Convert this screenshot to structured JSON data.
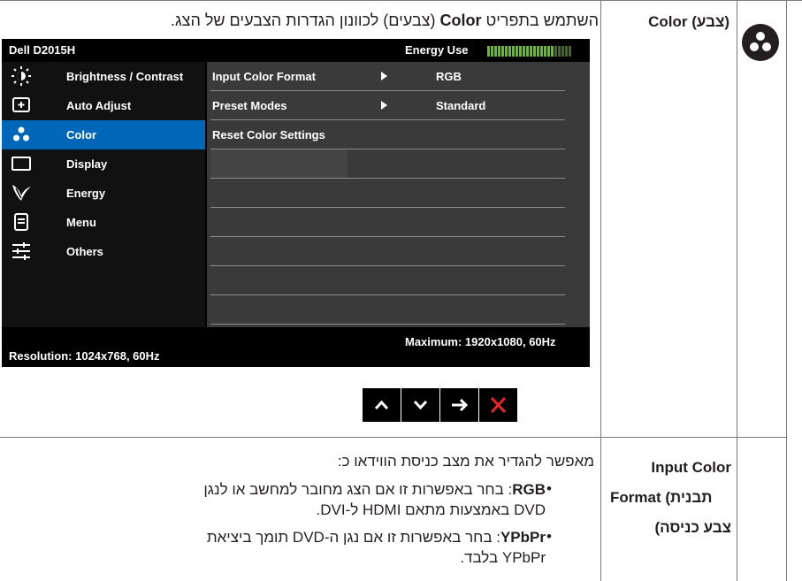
{
  "top_section": {
    "label": "Color (צבע)",
    "description_pre": "השתמש בתפריט ",
    "description_bold": "Color",
    "description_post": " (צבעים) לכוונון הגדרות הצבעים של הצג."
  },
  "osd": {
    "model": "Dell D2015H",
    "energy_label": "Energy Use",
    "energy_level": 0.8,
    "menu_items": [
      {
        "label": "Brightness / Contrast",
        "icon": "brightness-icon"
      },
      {
        "label": "Auto Adjust",
        "icon": "auto-adjust-icon"
      },
      {
        "label": "Color",
        "icon": "color-icon",
        "active": true
      },
      {
        "label": "Display",
        "icon": "display-icon"
      },
      {
        "label": "Energy",
        "icon": "energy-leaf-icon"
      },
      {
        "label": "Menu",
        "icon": "menu-icon"
      },
      {
        "label": "Others",
        "icon": "others-sliders-icon"
      }
    ],
    "submenu": [
      {
        "label": "Input Color Format",
        "value": "RGB",
        "has_arrow": true
      },
      {
        "label": "Preset Modes",
        "value": "Standard",
        "has_arrow": true
      },
      {
        "label": "Reset Color Settings",
        "value": "",
        "has_arrow": false
      }
    ],
    "resolution": "Resolution: 1024x768, 60Hz",
    "maximum": "Maximum: 1920x1080, 60Hz",
    "active_color": "#0067b8"
  },
  "nav_buttons": [
    {
      "icon": "chevron-up-icon"
    },
    {
      "icon": "chevron-down-icon"
    },
    {
      "icon": "arrow-right-icon"
    },
    {
      "icon": "close-x-icon",
      "color": "#e8262c"
    }
  ],
  "bottom_section": {
    "label_line1": "Input Color",
    "label_line2": "Format (תבנית",
    "label_line3": "צבע כניסה)",
    "intro": "מאפשר להגדיר את מצב כניסת הווידאו כ:",
    "bullets": [
      {
        "bold": "RGB",
        "line1": ": בחר באפשרות זו אם הצג מחובר למחשב או לנגן",
        "line2": "DVD באמצעות מתאם HDMI ל-DVI."
      },
      {
        "bold": "YPbPr",
        "line1": ": בחר באפשרות זו אם נגן ה-DVD תומך ביציאת",
        "line2": "YPbPr בלבד."
      }
    ]
  }
}
